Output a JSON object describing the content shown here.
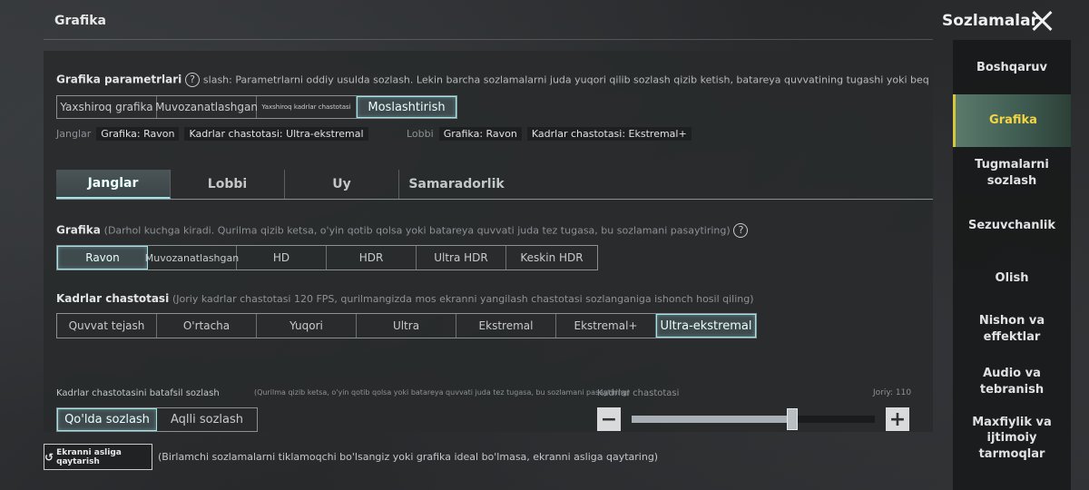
{
  "header": {
    "left_title": "Grafika",
    "right_title": "Sozlamalar"
  },
  "graphics_params": {
    "label": "Grafika parametrlari",
    "description": "slash: Parametrlarni oddiy usulda sozlash. Lekin barcha sozlamalarni juda yuqori qilib sozlash qizib ketish, batareya quvvatining tugashi yoki beqaror geympley |",
    "options": [
      "Yaxshiroq grafika",
      "Muvozanatlashgan",
      "Yaxshiroq kadrlar chastotasi",
      "Moslashtirish"
    ],
    "selected": "Moslashtirish",
    "battle_label": "Janglar",
    "battle_tags": [
      "Grafika: Ravon",
      "Kadrlar chastotasi: Ultra-ekstremal"
    ],
    "lobby_label": "Lobbi",
    "lobby_tags": [
      "Grafika: Ravon",
      "Kadrlar chastotasi: Ekstremal+"
    ]
  },
  "tabs": [
    "Janglar",
    "Lobbi",
    "Uy",
    "Samaradorlik"
  ],
  "active_tab": "Janglar",
  "graphics": {
    "label": "Grafika",
    "note": "(Darhol kuchga kiradi. Qurilma qizib ketsa, o'yin qotib qolsa yoki batareya quvvati juda tez tugasa, bu sozlamani pasaytiring)",
    "options": [
      "Ravon",
      "Muvozanatlashgan",
      "HD",
      "HDR",
      "Ultra HDR",
      "Keskin HDR"
    ],
    "selected": "Ravon"
  },
  "frame_rate": {
    "label": "Kadrlar chastotasi",
    "note": "(Joriy kadrlar chastotasi 120 FPS, qurilmangizda mos ekranni yangilash chastotasi sozlanganiga ishonch hosil qiling)",
    "options": [
      "Quvvat tejash",
      "O'rtacha",
      "Yuqori",
      "Ultra",
      "Ekstremal",
      "Ekstremal+",
      "Ultra-ekstremal"
    ],
    "selected": "Ultra-ekstremal"
  },
  "detailed": {
    "label": "Kadrlar chastotasini batafsil sozlash",
    "note": "(Qurilma qizib ketsa, o'yin qotib qolsa yoki batareya quvvati juda tez tugasa, bu sozlamani pasaytiring)",
    "modes": [
      "Qo'lda sozlash",
      "Aqlli sozlash"
    ],
    "selected_mode": "Qo'lda sozlash",
    "slider_label": "Kadrlar chastotasi",
    "current_label": "Joriy: 110",
    "slider_fraction": 0.66,
    "minus": "−",
    "plus": "+"
  },
  "reset": {
    "button_label": "Ekranni asliga qaytarish",
    "icon": "undo-icon",
    "hint": "(Birlamchi sozlamalarni tiklamoqchi bo'lsangiz yoki grafika ideal bo'lmasa, ekranni asliga qaytaring)"
  },
  "sidebar": {
    "items": [
      "Boshqaruv",
      "Grafika",
      "Tugmalarni sozlash",
      "Sezuvchanlik",
      "Olish",
      "Nishon va effektlar",
      "Audio va tebranish",
      "Maxfiylik va ijtimoiy tarmoqlar"
    ],
    "active": "Grafika"
  },
  "colors": {
    "accent": "#9ee4e4",
    "sidebar_active_text": "#f5d642"
  }
}
